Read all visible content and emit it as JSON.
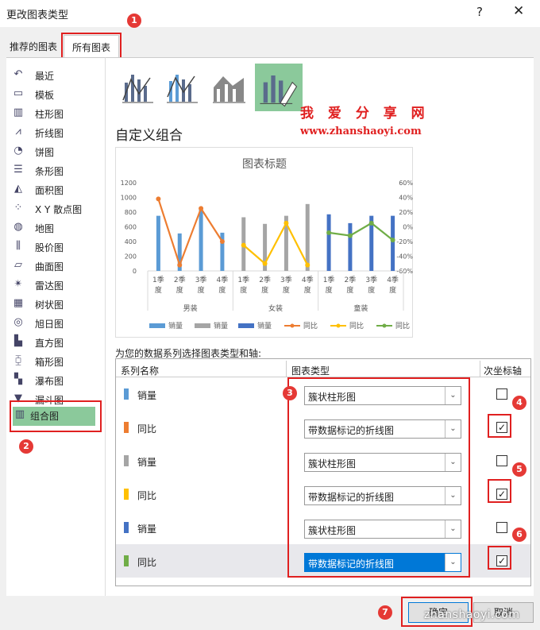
{
  "window": {
    "title": "更改图表类型",
    "help": "?",
    "close": "✕"
  },
  "tabs": {
    "recommended": "推荐的图表",
    "all": "所有图表"
  },
  "categories": [
    {
      "label": "最近",
      "icon": "recent-icon",
      "glyph": "↶"
    },
    {
      "label": "模板",
      "icon": "template-icon",
      "glyph": "▭"
    },
    {
      "label": "柱形图",
      "icon": "column-chart-icon",
      "glyph": "▥"
    },
    {
      "label": "折线图",
      "icon": "line-chart-icon",
      "glyph": "⩘"
    },
    {
      "label": "饼图",
      "icon": "pie-chart-icon",
      "glyph": "◔"
    },
    {
      "label": "条形图",
      "icon": "bar-chart-icon",
      "glyph": "☰"
    },
    {
      "label": "面积图",
      "icon": "area-chart-icon",
      "glyph": "◭"
    },
    {
      "label": "X Y 散点图",
      "icon": "scatter-chart-icon",
      "glyph": "⁘"
    },
    {
      "label": "地图",
      "icon": "map-chart-icon",
      "glyph": "◍"
    },
    {
      "label": "股价图",
      "icon": "stock-chart-icon",
      "glyph": "⫼"
    },
    {
      "label": "曲面图",
      "icon": "surface-chart-icon",
      "glyph": "▱"
    },
    {
      "label": "雷达图",
      "icon": "radar-chart-icon",
      "glyph": "✴"
    },
    {
      "label": "树状图",
      "icon": "treemap-chart-icon",
      "glyph": "▦"
    },
    {
      "label": "旭日图",
      "icon": "sunburst-chart-icon",
      "glyph": "◎"
    },
    {
      "label": "直方图",
      "icon": "histogram-chart-icon",
      "glyph": "▙"
    },
    {
      "label": "箱形图",
      "icon": "box-whisker-chart-icon",
      "glyph": "⧮"
    },
    {
      "label": "瀑布图",
      "icon": "waterfall-chart-icon",
      "glyph": "▚"
    },
    {
      "label": "漏斗图",
      "icon": "funnel-chart-icon",
      "glyph": "▼"
    },
    {
      "label": "组合图",
      "icon": "combo-chart-icon",
      "glyph": "▥"
    }
  ],
  "heading": "自定义组合",
  "watermark": {
    "line1": "我 爱 分 享 网",
    "line2": "www.zhanshaoyi.com",
    "line3": "zhanshaoyi.com"
  },
  "chart_data": {
    "type": "bar",
    "title": "图表标题",
    "primary_ylim": [
      0,
      1200
    ],
    "primary_ticks": [
      "0",
      "200",
      "400",
      "600",
      "800",
      "1000",
      "1200"
    ],
    "secondary_ylim": [
      -60,
      60
    ],
    "secondary_ticks": [
      "-60%",
      "-40%",
      "-20%",
      "0%",
      "20%",
      "40%",
      "60%"
    ],
    "groups": [
      "男装",
      "女装",
      "童装"
    ],
    "quarters": [
      [
        "1季",
        "度"
      ],
      [
        "2季",
        "度"
      ],
      [
        "3季",
        "度"
      ],
      [
        "4季",
        "度"
      ]
    ],
    "series": [
      {
        "name": "销量",
        "kind": "bar",
        "group": 0,
        "color": "#5b9bd5",
        "values": [
          750,
          510,
          870,
          520
        ]
      },
      {
        "name": "同比",
        "kind": "line",
        "group": 0,
        "color": "#ed7d31",
        "values": [
          38,
          -52,
          25,
          -20
        ]
      },
      {
        "name": "销量",
        "kind": "bar",
        "group": 1,
        "color": "#a5a5a5",
        "values": [
          730,
          640,
          750,
          910
        ]
      },
      {
        "name": "同比",
        "kind": "line",
        "group": 1,
        "color": "#ffc000",
        "values": [
          -25,
          -50,
          5,
          -52
        ]
      },
      {
        "name": "销量",
        "kind": "bar",
        "group": 2,
        "color": "#4472c4",
        "values": [
          770,
          650,
          750,
          750
        ]
      },
      {
        "name": "同比",
        "kind": "line",
        "group": 2,
        "color": "#70ad47",
        "values": [
          -8,
          -12,
          5,
          -18
        ]
      }
    ],
    "legend": [
      "销量",
      "销量",
      "销量",
      "同比",
      "同比",
      "同比"
    ],
    "legend_placement": "bottom",
    "grid": false
  },
  "instruction": "为您的数据系列选择图表类型和轴:",
  "table": {
    "headers": {
      "name": "系列名称",
      "type": "图表类型",
      "axis": "次坐标轴"
    },
    "rows": [
      {
        "name": "销量",
        "color": "#5b9bd5",
        "type": "簇状柱形图",
        "secondary": false
      },
      {
        "name": "同比",
        "color": "#ed7d31",
        "type": "带数据标记的折线图",
        "secondary": true
      },
      {
        "name": "销量",
        "color": "#a5a5a5",
        "type": "簇状柱形图",
        "secondary": false
      },
      {
        "name": "同比",
        "color": "#ffc000",
        "type": "带数据标记的折线图",
        "secondary": true
      },
      {
        "name": "销量",
        "color": "#4472c4",
        "type": "簇状柱形图",
        "secondary": false
      },
      {
        "name": "同比",
        "color": "#70ad47",
        "type": "带数据标记的折线图",
        "secondary": true
      }
    ]
  },
  "buttons": {
    "ok": "确定",
    "cancel": "取消"
  },
  "badges": [
    "1",
    "2",
    "3",
    "4",
    "5",
    "6",
    "7"
  ]
}
